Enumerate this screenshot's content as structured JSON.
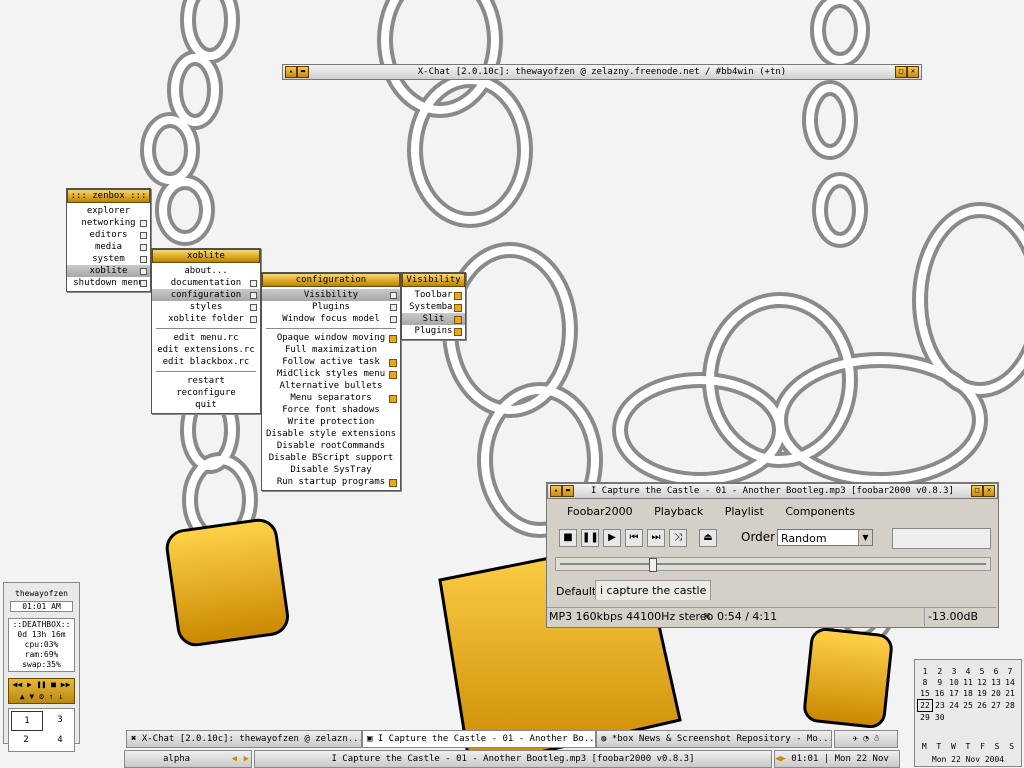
{
  "xchat_window": {
    "title": "X-Chat [2.0.10c]: thewayofzen @ zelazny.freenode.net / #bb4win (+tn)"
  },
  "zenbox_menu": {
    "title": "::: zenbox :::",
    "items": [
      "explorer",
      "networking",
      "editors",
      "media",
      "system",
      "xoblite",
      "shutdown menu"
    ]
  },
  "xoblite_menu": {
    "title": "xoblite",
    "items": [
      "about...",
      "documentation",
      "configuration",
      "styles",
      "xoblite folder"
    ],
    "items2": [
      "edit menu.rc",
      "edit extensions.rc",
      "edit blackbox.rc"
    ],
    "items3": [
      "restart",
      "reconfigure",
      "quit"
    ]
  },
  "config_menu": {
    "title": "configuration",
    "items": [
      "Visibility",
      "Plugins",
      "Window focus model"
    ],
    "items2": [
      "Opaque window moving",
      "Full maximization",
      "Follow active task",
      "MidClick styles menu",
      "Alternative bullets",
      "Menu separators",
      "Force font shadows",
      "Write protection",
      "Disable style extensions",
      "Disable rootCommands",
      "Disable BScript support",
      "Disable SysTray",
      "Run startup programs"
    ]
  },
  "visibility_menu": {
    "title": "Visibility",
    "items": [
      "Toolbar",
      "Systembar",
      "Slit",
      "Plugins"
    ]
  },
  "foobar": {
    "title": "I Capture the Castle - 01 - Another Bootleg.mp3   [foobar2000 v0.8.3]",
    "menu": [
      "Foobar2000",
      "Playback",
      "Playlist",
      "Components"
    ],
    "order_label": "Order",
    "order_value": "Random",
    "tabs": [
      "Default",
      "i capture the castle"
    ],
    "status_format": "MP3 160kbps 44100Hz stereo",
    "status_time": "0:54 / 4:11",
    "status_gain": "-13.00dB",
    "seek_fraction": 0.21
  },
  "sysmon": {
    "user": "thewayofzen",
    "time": "01:01 AM",
    "host": "::DEATHBOX::",
    "uptime": "0d 13h 16m",
    "cpu": "cpu:03%",
    "ram": "ram:69%",
    "swap": "swap:35%"
  },
  "workspaces": [
    "1",
    "3",
    "2",
    "4"
  ],
  "taskbar": {
    "tasks": [
      "X-Chat [2.0.10c]: thewayofzen @ zelazn...",
      "I Capture the Castle - 01 - Another Bo...",
      "*box News & Screenshot Repository - Mo..."
    ],
    "workspace_name": "alpha",
    "current_window": "I Capture the Castle - 01 - Another Bootleg.mp3   [foobar2000 v0.8.3]",
    "clock": "01:01 | Mon 22 Nov"
  },
  "calendar": {
    "rows": [
      [
        "1",
        "2",
        "3",
        "4",
        "5",
        "6",
        "7"
      ],
      [
        "8",
        "9",
        "10",
        "11",
        "12",
        "13",
        "14"
      ],
      [
        "15",
        "16",
        "17",
        "18",
        "19",
        "20",
        "21"
      ],
      [
        "22",
        "23",
        "24",
        "25",
        "26",
        "27",
        "28"
      ],
      [
        "29",
        "30",
        "",
        "",
        "",
        "",
        ""
      ]
    ],
    "today": "22",
    "weekdays": [
      "M",
      "T",
      "W",
      "T",
      "F",
      "S",
      "S"
    ],
    "date": "Mon 22 Nov 2004"
  }
}
